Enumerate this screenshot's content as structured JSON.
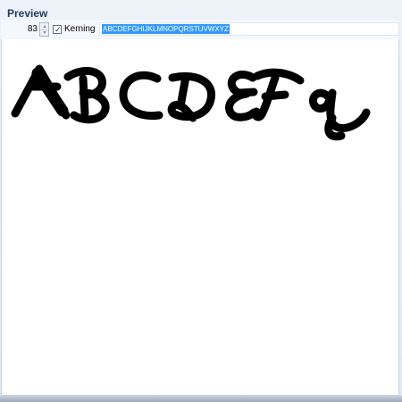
{
  "panel": {
    "title": "Preview"
  },
  "toolbar": {
    "font_size_value": "83",
    "kerning_checked": true,
    "kerning_label": "Kerning",
    "preview_text_value": "ABCDEFGHIJKLMNOPQRSTUVWXYZ"
  },
  "preview": {
    "rendered_glyphs": [
      "A",
      "B",
      "C",
      "D",
      "E",
      "F",
      "g"
    ],
    "ink_color": "#000000",
    "background_color": "#ffffff"
  },
  "icons": {
    "spin_up": "chevron-up-icon",
    "spin_down": "chevron-down-icon",
    "check": "checkmark-icon"
  }
}
